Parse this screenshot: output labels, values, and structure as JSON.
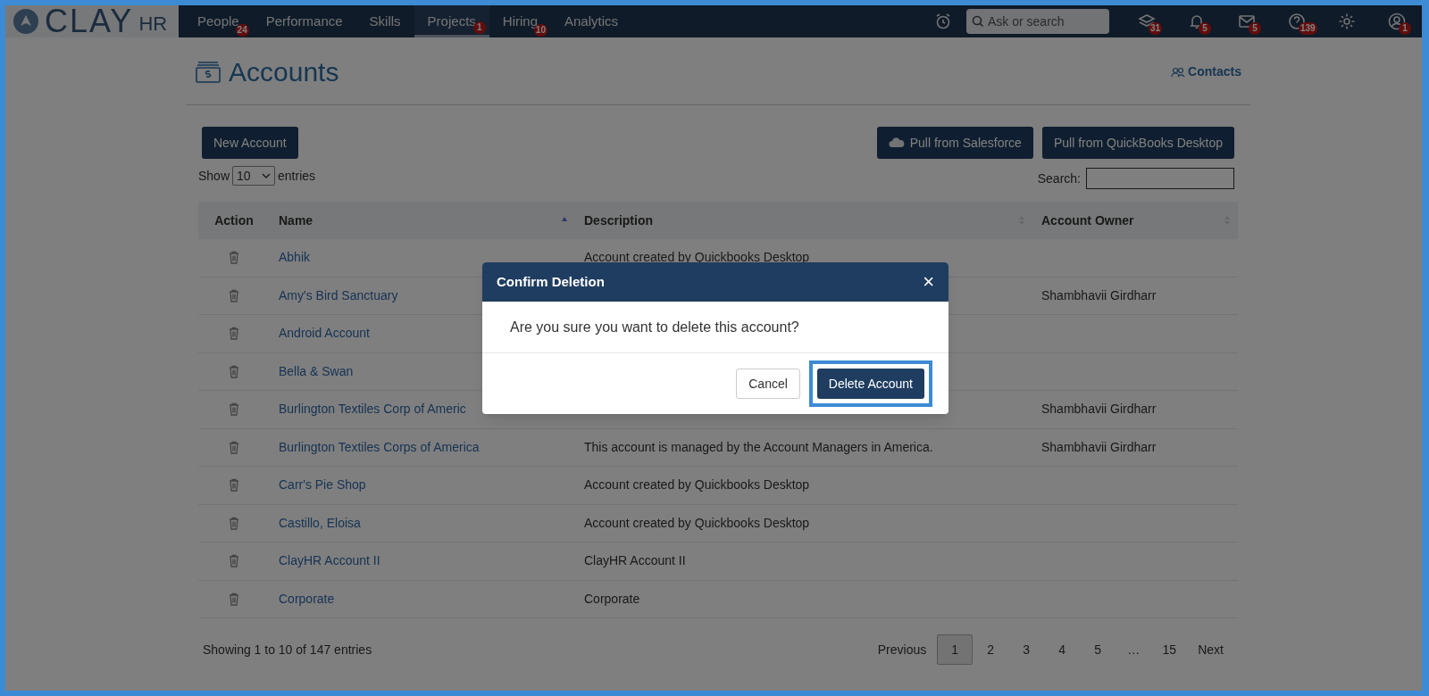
{
  "nav": {
    "logo": {
      "main": "CLAY",
      "sub": "HR"
    },
    "items": [
      {
        "label": "People",
        "badge": "24",
        "selected": false
      },
      {
        "label": "Performance",
        "selected": false
      },
      {
        "label": "Skills",
        "selected": false
      },
      {
        "label": "Projects",
        "badge": "1",
        "selected": true
      },
      {
        "label": "Hiring",
        "badge": "10",
        "selected": false
      },
      {
        "label": "Analytics",
        "selected": false
      }
    ],
    "search": {
      "placeholder": "Ask or search"
    },
    "icons": [
      {
        "kind": "stack",
        "badge": "31"
      },
      {
        "kind": "bell",
        "badge": "5"
      },
      {
        "kind": "mail",
        "badge": "5"
      },
      {
        "kind": "help",
        "badge": "139"
      },
      {
        "kind": "gear"
      },
      {
        "kind": "avatar",
        "badge": "1"
      }
    ]
  },
  "page": {
    "title": "Accounts",
    "contacts_link": "Contacts",
    "buttons": {
      "new": "New Account",
      "salesforce": "Pull from Salesforce",
      "quickbooks": "Pull from QuickBooks Desktop"
    },
    "show": {
      "before": "Show",
      "value": "10",
      "after": "entries"
    },
    "search_label": "Search:",
    "table": {
      "columns": [
        {
          "label": "Action"
        },
        {
          "label": "Name",
          "kind": "sorted"
        },
        {
          "label": "Description",
          "kind": "sortable"
        },
        {
          "label": "Account Owner",
          "kind": "sortable"
        }
      ],
      "rows": [
        {
          "name": "Abhik",
          "description": "Account created by Quickbooks Desktop"
        },
        {
          "name": "Amy's Bird Sanctuary",
          "owner": "Shambhavii Girdharr"
        },
        {
          "name": "Android Account"
        },
        {
          "name": "Bella & Swan"
        },
        {
          "name": "Burlington Textiles Corp of Americ",
          "owner": "Shambhavii Girdharr"
        },
        {
          "name": "Burlington Textiles Corps of America",
          "description": "This account is managed by the Account Managers in America.",
          "owner": "Shambhavii Girdharr"
        },
        {
          "name": "Carr's Pie Shop",
          "description": "Account created by Quickbooks Desktop"
        },
        {
          "name": "Castillo, Eloisa",
          "description": "Account created by Quickbooks Desktop"
        },
        {
          "name": "ClayHR Account II",
          "description": "ClayHR Account II"
        },
        {
          "name": "Corporate",
          "description": "Corporate"
        }
      ]
    },
    "info": "Showing 1 to 10 of 147 entries",
    "pagination": [
      {
        "label": "Previous",
        "selected": false
      },
      {
        "label": "1",
        "selected": true
      },
      {
        "label": "2",
        "selected": false
      },
      {
        "label": "3",
        "selected": false
      },
      {
        "label": "4",
        "selected": false
      },
      {
        "label": "5",
        "selected": false
      },
      {
        "label": "…",
        "selected": false
      },
      {
        "label": "15",
        "selected": false
      },
      {
        "label": "Next",
        "selected": false
      }
    ]
  },
  "dialog": {
    "title": "Confirm Deletion",
    "close": "×",
    "message": "Are you sure you want to delete this account?",
    "cancel": "Cancel",
    "confirm": "Delete Account",
    "confirm_highlighted": true
  }
}
